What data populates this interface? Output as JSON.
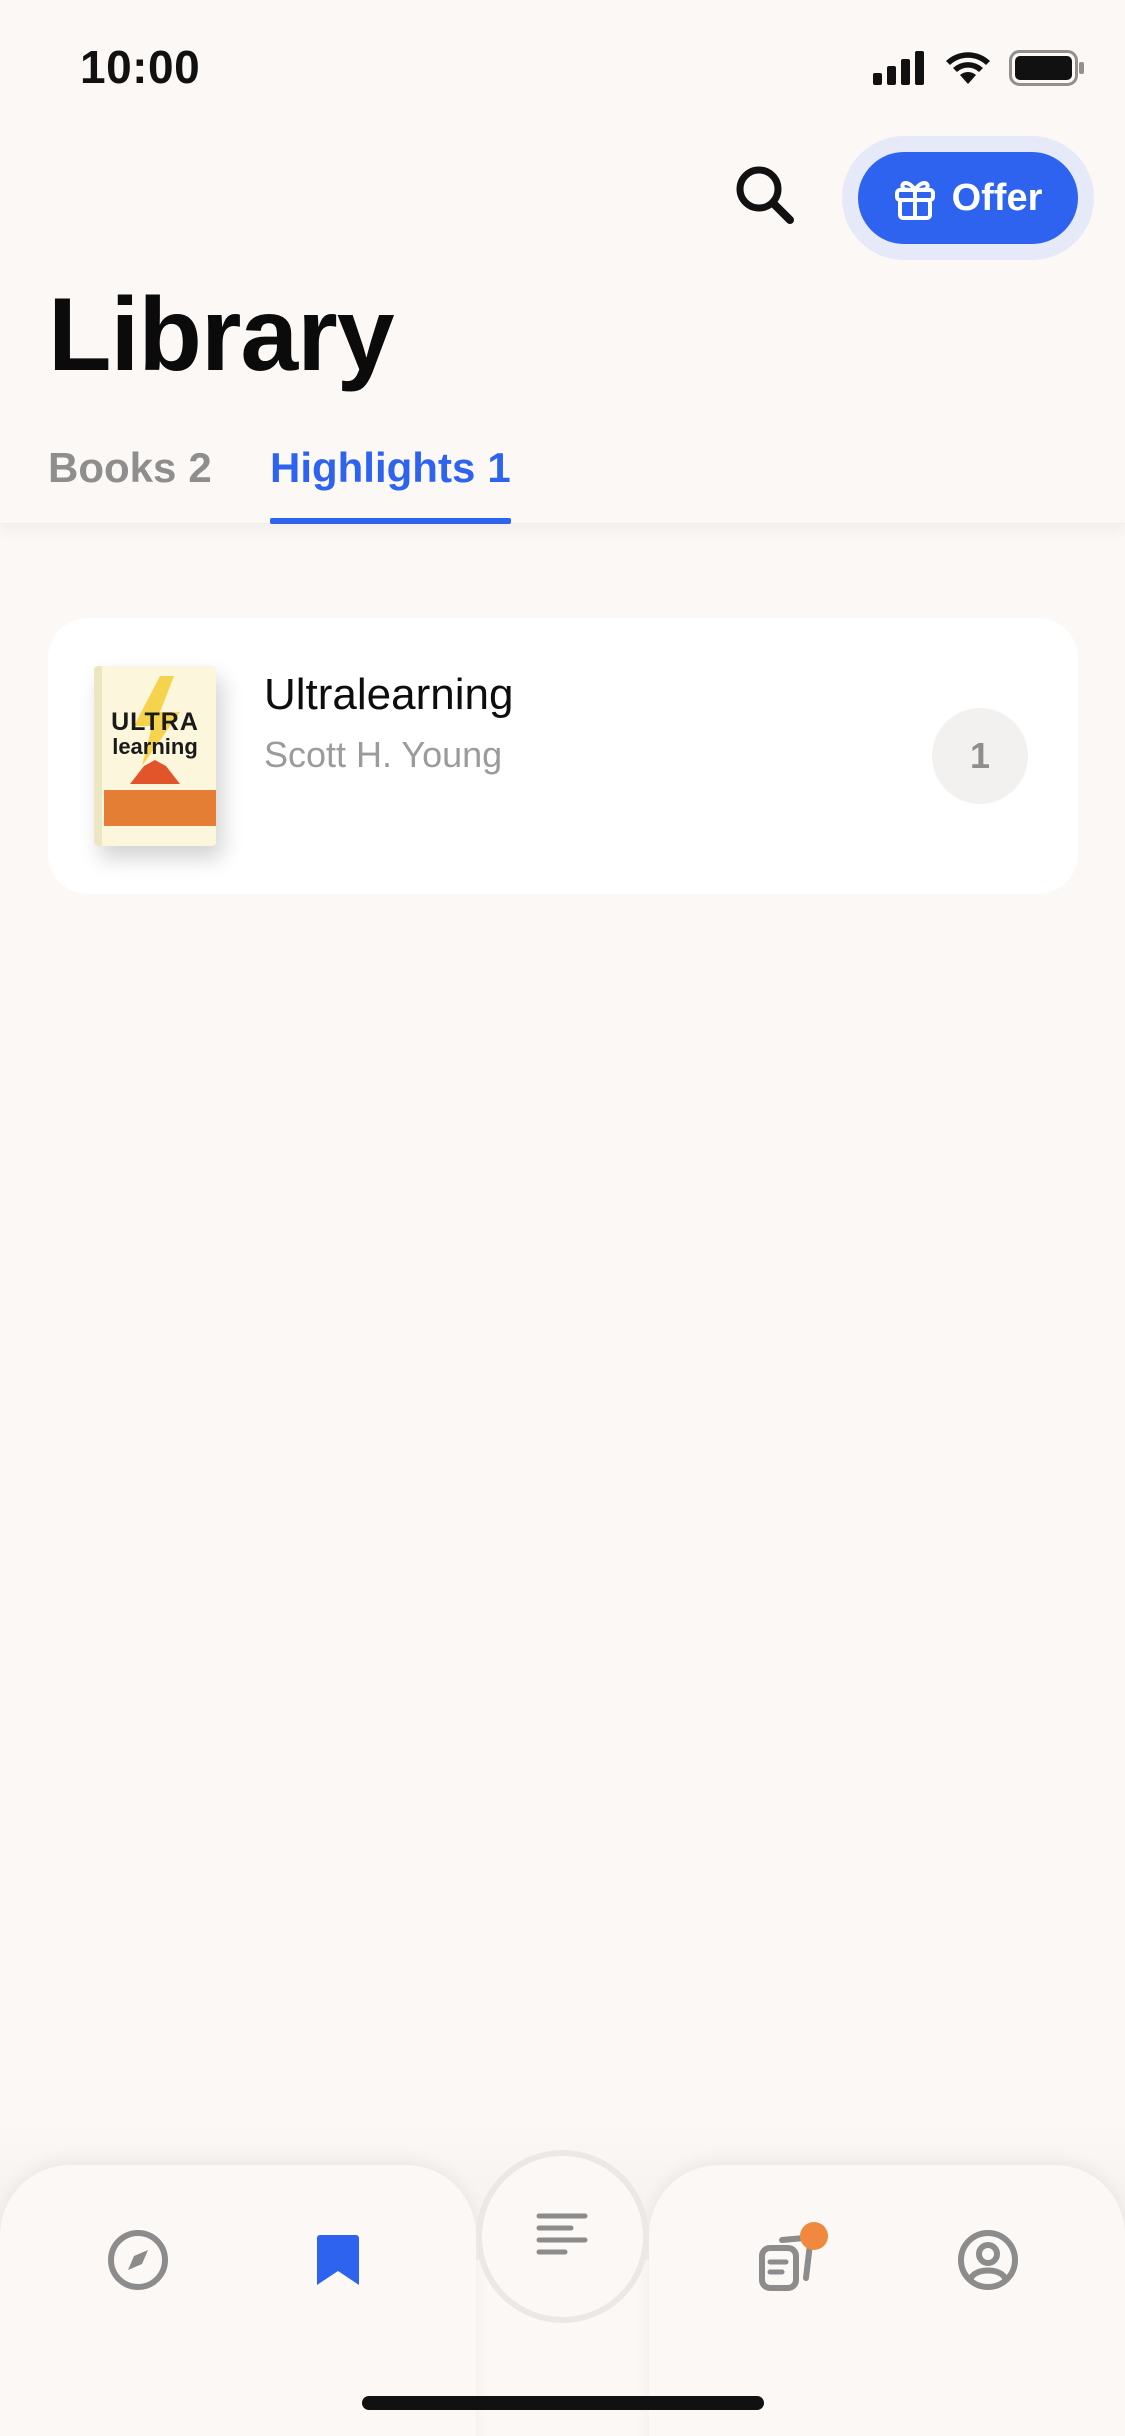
{
  "status_bar": {
    "time": "10:00"
  },
  "header": {
    "search_icon": "search-icon",
    "offer_label": "Offer",
    "title": "Library"
  },
  "tabs": [
    {
      "label": "Books",
      "count": "2",
      "active": false
    },
    {
      "label": "Highlights",
      "count": "1",
      "active": true
    }
  ],
  "highlights": [
    {
      "cover_title": "ULTRA",
      "cover_subtitle": "learning",
      "title": "Ultralearning",
      "author": "Scott H. Young",
      "count": "1"
    }
  ],
  "nav": {
    "items": [
      "compass-icon",
      "bookmark-icon",
      "text-lines-icon",
      "flashcards-icon",
      "profile-icon"
    ],
    "active": "bookmark-icon",
    "notification_dot": true
  },
  "colors": {
    "accent": "#2e63f0",
    "background": "#fcf8f5",
    "notification": "#f0893e"
  }
}
